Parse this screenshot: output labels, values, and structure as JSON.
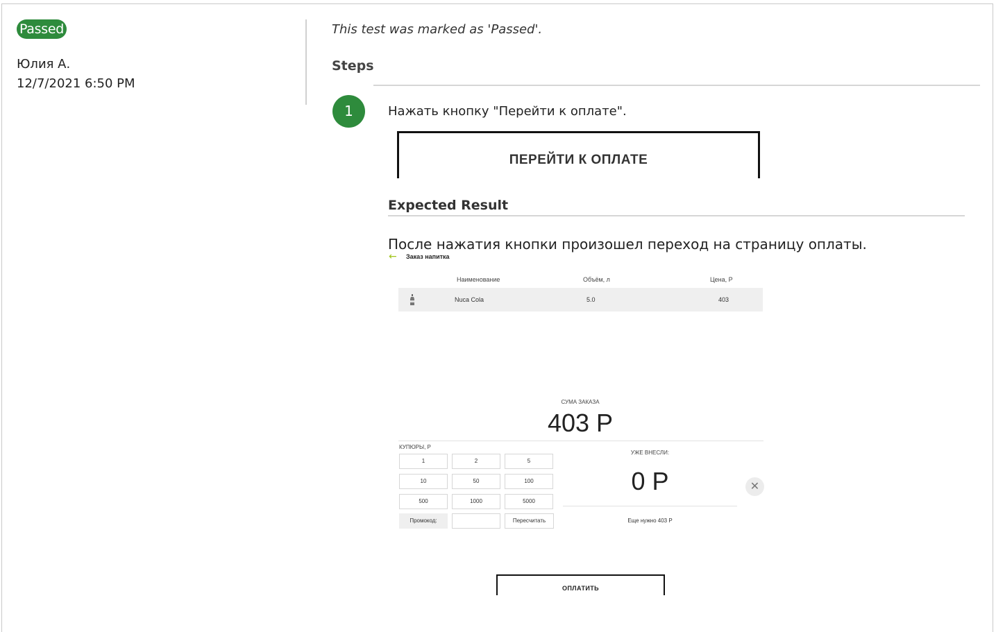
{
  "result": {
    "status": "Passed",
    "author": "Юлия А.",
    "timestamp": "12/7/2021 6:50 PM",
    "note": "This test was marked as 'Passed'."
  },
  "steps": {
    "heading": "Steps",
    "items": [
      {
        "number": "1",
        "action": "Нажать кнопку \"Перейти к оплате\".",
        "action_image_button": "ПЕРЕЙТИ К ОПЛАТЕ",
        "expected_heading": "Expected Result",
        "expected_text": "После нажатия кнопки произошел переход на страницу оплаты."
      }
    ]
  },
  "payment_page": {
    "title": "Заказ напитка",
    "table": {
      "columns": [
        "Наименование",
        "Объём, л",
        "Цена, Р"
      ],
      "rows": [
        [
          "Nuca Cola",
          "5.0",
          "403"
        ]
      ]
    },
    "sum_label": "СУМА ЗАКАЗА",
    "sum_value": "403 Р",
    "bills_label": "КУПЮРЫ, Р",
    "bills": [
      "1",
      "2",
      "5",
      "10",
      "50",
      "100",
      "500",
      "1000",
      "5000"
    ],
    "promo_label": "Промокод:",
    "promo_value": "",
    "recalc_label": "Пересчитать",
    "paid_label": "УЖЕ ВНЕСЛИ:",
    "paid_value": "0 Р",
    "remaining": "Еще нужно 403 Р",
    "pay_button": "ОПЛАТИТЬ"
  },
  "colors": {
    "passed": "#2e8b3c",
    "accent_arrow": "#a0c41a"
  },
  "icons": {
    "back": "arrow-left-icon",
    "clear": "close-icon",
    "product": "bottle-icon"
  }
}
